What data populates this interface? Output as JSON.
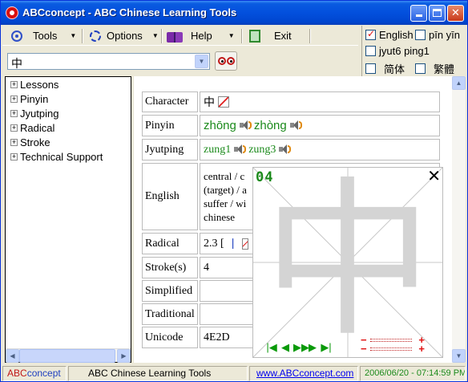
{
  "window": {
    "title": "ABCconcept - ABC Chinese Learning Tools"
  },
  "toolbar": {
    "tools_label": "Tools",
    "options_label": "Options",
    "help_label": "Help",
    "exit_label": "Exit"
  },
  "search": {
    "value": "中"
  },
  "languages": {
    "english": {
      "label": "English",
      "checked": true
    },
    "pinyin": {
      "label": "pīn yīn",
      "checked": false
    },
    "jyutping": {
      "label": "jyut6 ping1",
      "checked": false
    },
    "simplified": {
      "label": "简体",
      "checked": false
    },
    "traditional": {
      "label": "繁體",
      "checked": false
    }
  },
  "tree": {
    "items": [
      {
        "label": "Lessons"
      },
      {
        "label": "Pinyin"
      },
      {
        "label": "Jyutping"
      },
      {
        "label": "Radical"
      },
      {
        "label": "Stroke"
      },
      {
        "label": "Technical Support"
      }
    ]
  },
  "detail": {
    "labels": {
      "character": "Character",
      "pinyin": "Pinyin",
      "jyutping": "Jyutping",
      "english": "English",
      "radical": "Radical",
      "strokes": "Stroke(s)",
      "simplified": "Simplified",
      "traditional": "Traditional",
      "unicode": "Unicode"
    },
    "values": {
      "character": "中",
      "pinyin_1": "zhōng",
      "pinyin_2": "zhòng",
      "jyutping_1": "zung1",
      "jyutping_2": "zung3",
      "english_1": "central / c",
      "english_2": "(target) / a",
      "english_3": "suffer / wi",
      "english_4": "chinese",
      "radical": "2.3 [",
      "radical_char": "丨",
      "strokes": "4",
      "simplified": "",
      "traditional": "",
      "unicode": "4E2D"
    }
  },
  "stroke_animation": {
    "count": "04",
    "character": "中",
    "controls": [
      "|◀",
      "◀",
      "▶▶",
      "▶",
      "▶|"
    ],
    "speed_minus": "−",
    "speed_plus": "+"
  },
  "status": {
    "brand_1": "ABC",
    "brand_2": "concept",
    "app_name": "ABC Chinese Learning Tools",
    "url": "www.ABCconcept.com",
    "datetime": "2006/06/20 - 07:14:59 PM"
  },
  "colors": {
    "titlebar": "#0350dd",
    "pinyin_green": "#1b8a1b",
    "brand_red": "#c01818",
    "brand_blue": "#2040c0"
  }
}
